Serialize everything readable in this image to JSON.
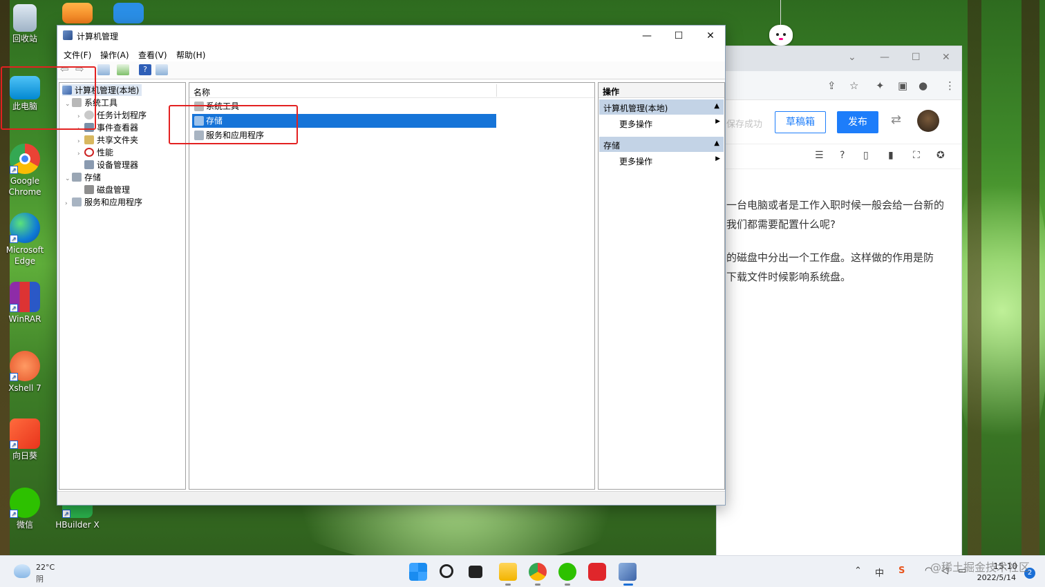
{
  "desktop": {
    "icons": [
      {
        "label": "回收站"
      },
      {
        "label": "此电脑"
      },
      {
        "label": "Google Chrome"
      },
      {
        "label": "Microsoft Edge"
      },
      {
        "label": "WinRAR"
      },
      {
        "label": "Xshell 7"
      },
      {
        "label": "向日葵"
      },
      {
        "label": "微信"
      },
      {
        "label": "HBuilder X"
      }
    ]
  },
  "browser": {
    "save_status": "保存成功",
    "draft_button": "草稿箱",
    "publish_button": "发布",
    "paragraphs": [
      "一台电脑或者是工作入职时候一般会给一台新的",
      "我们都需要配置什么呢?",
      "的磁盘中分出一个工作盘。这样做的作用是防",
      "下载文件时候影响系统盘。"
    ]
  },
  "mmc": {
    "title": "计算机管理",
    "menu": [
      "文件(F)",
      "操作(A)",
      "查看(V)",
      "帮助(H)"
    ],
    "tree": {
      "root": "计算机管理(本地)",
      "system_tools": "系统工具",
      "task_scheduler": "任务计划程序",
      "event_viewer": "事件查看器",
      "shared_folders": "共享文件夹",
      "performance": "性能",
      "device_manager": "设备管理器",
      "storage": "存储",
      "disk_management": "磁盘管理",
      "services_apps": "服务和应用程序"
    },
    "list": {
      "column_name": "名称",
      "rows": [
        "系统工具",
        "存储",
        "服务和应用程序"
      ],
      "selected": "存储"
    },
    "actions": {
      "header": "操作",
      "group1": "计算机管理(本地)",
      "group1_more": "更多操作",
      "group2": "存储",
      "group2_more": "更多操作"
    }
  },
  "taskbar": {
    "temperature": "22°C",
    "weather": "阴",
    "ime": "中",
    "time": "15:10",
    "date": "2022/5/14",
    "notifications": "2",
    "watermark": "@稀土掘金技术社区"
  },
  "colors": {
    "selection": "#1674d8",
    "highlight_box": "#e32020",
    "primary_button": "#1d7dfa",
    "action_group": "#c3d3e6"
  }
}
